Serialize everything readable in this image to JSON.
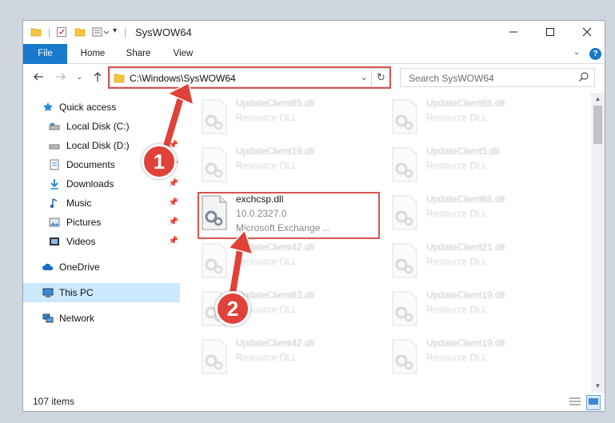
{
  "window": {
    "title": "SysWOW64",
    "controls": [
      "minimize",
      "maximize",
      "close"
    ]
  },
  "ribbon": {
    "tabs": [
      {
        "label": "File"
      },
      {
        "label": "Home"
      },
      {
        "label": "Share"
      },
      {
        "label": "View"
      }
    ]
  },
  "address": {
    "path": "C:\\Windows\\SysWOW64"
  },
  "search": {
    "placeholder": "Search SysWOW64"
  },
  "sidebar": {
    "items": [
      {
        "label": "Quick access",
        "icon": "star-icon"
      },
      {
        "label": "Local Disk (C:)",
        "icon": "drive-icon"
      },
      {
        "label": "Local Disk (D:)",
        "icon": "drive-icon",
        "pinned": true
      },
      {
        "label": "Documents",
        "icon": "documents-icon",
        "pinned": true
      },
      {
        "label": "Downloads",
        "icon": "download-icon",
        "pinned": true
      },
      {
        "label": "Music",
        "icon": "music-icon",
        "pinned": true
      },
      {
        "label": "Pictures",
        "icon": "pictures-icon",
        "pinned": true
      },
      {
        "label": "Videos",
        "icon": "videos-icon",
        "pinned": true
      },
      {
        "label": "OneDrive",
        "icon": "cloud-icon"
      },
      {
        "label": "This PC",
        "icon": "computer-icon",
        "selected": true
      },
      {
        "label": "Network",
        "icon": "network-icon"
      }
    ]
  },
  "files": [
    {
      "name": "UpdateClient65.dll",
      "desc": "Resource DLL"
    },
    {
      "name": "UpdateClient65.dll",
      "desc": "Resource DLL"
    },
    {
      "name": "UpdateClient19.dll",
      "desc": "Resource DLL"
    },
    {
      "name": "UpdateClient5.dll",
      "desc": "Resource DLL"
    },
    {
      "name": "exchcsp.dll",
      "desc": "10.0.2327.0",
      "desc2": "Microsoft Exchange ...",
      "highlight": true
    },
    {
      "name": "UpdateClient65.dll",
      "desc": "Resource DLL"
    },
    {
      "name": "UpdateClient42.dll",
      "desc": "Resource DLL"
    },
    {
      "name": "UpdateClient21.dll",
      "desc": "Resource DLL"
    },
    {
      "name": "UpdateClient63.dll",
      "desc": "Resource DLL"
    },
    {
      "name": "UpdateClient19.dll",
      "desc": "Resource DLL"
    },
    {
      "name": "UpdateClient42.dll",
      "desc": "Resource DLL"
    },
    {
      "name": "UpdateClient19.dll",
      "desc": "Resource DLL"
    }
  ],
  "status": {
    "item_count": "107 items"
  },
  "annotations": {
    "marker1": "1",
    "marker2": "2"
  },
  "colors": {
    "accent": "#1979ca",
    "annotation": "#e0423a",
    "selection": "#cce8ff"
  }
}
